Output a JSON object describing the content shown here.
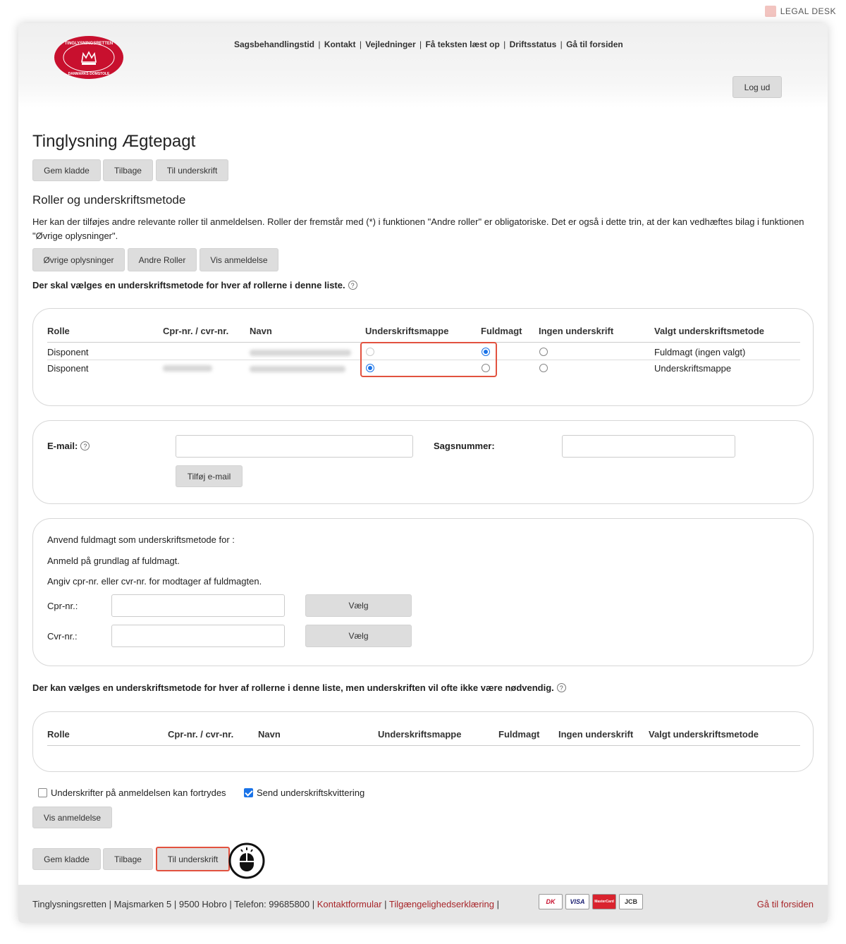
{
  "brand": {
    "name": "LEGAL DESK"
  },
  "header": {
    "nav": [
      "Sagsbehandlingstid",
      "Kontakt",
      "Vejledninger",
      "Få teksten læst op",
      "Driftsstatus",
      "Gå til forsiden"
    ],
    "logout_label": "Log ud",
    "seal_top": "TINGLYSNINGSRETTEN",
    "seal_bottom": "DANMARKS DOMSTOLE"
  },
  "page": {
    "title": "Tinglysning Ægtepagt",
    "actions": {
      "save": "Gem kladde",
      "back": "Tilbage",
      "sign": "Til underskrift"
    },
    "subtitle": "Roller og underskriftsmetode",
    "description": "Her kan der tilføjes andre relevante roller til anmeldelsen. Roller der fremstår med (*) i funktionen \"Andre roller\" er obligatoriske. Det er også i dette trin, at der kan vedhæftes bilag i funktionen \"Øvrige oplysninger\".",
    "section_tabs": {
      "other_info": "Øvrige oplysninger",
      "other_roles": "Andre Roller",
      "show_filing": "Vis anmeldelse"
    },
    "required_heading": "Der skal vælges en underskriftsmetode for hver af rollerne i denne liste.",
    "optional_heading": "Der kan vælges en underskriftsmetode for hver af rollerne i denne liste, men underskriften vil ofte ikke være nødvendig.",
    "help_glyph": "?"
  },
  "roles_table": {
    "columns": [
      "Rolle",
      "Cpr-nr. / cvr-nr.",
      "Navn",
      "Underskriftsmappe",
      "Fuldmagt",
      "Ingen underskrift",
      "Valgt underskriftsmetode"
    ],
    "rows": [
      {
        "role": "Disponent",
        "selected": "fuldmagt",
        "chosen_method": "Fuldmagt (ingen valgt)"
      },
      {
        "role": "Disponent",
        "selected": "underskriftsmappe",
        "chosen_method": "Underskriftsmappe"
      }
    ]
  },
  "email_panel": {
    "email_label": "E-mail:",
    "case_label": "Sagsnummer:",
    "add_email": "Tilføj e-mail"
  },
  "proxy_panel": {
    "line1": "Anvend fuldmagt som underskriftsmetode for :",
    "line2": "Anmeld på grundlag af fuldmagt.",
    "line3": "Angiv cpr-nr. eller cvr-nr. for modtager af fuldmagten.",
    "cpr_label": "Cpr-nr.:",
    "cvr_label": "Cvr-nr.:",
    "choose": "Vælg"
  },
  "optional_table": {
    "columns": [
      "Rolle",
      "Cpr-nr. / cvr-nr.",
      "Navn",
      "Underskriftsmappe",
      "Fuldmagt",
      "Ingen underskrift",
      "Valgt underskriftsmetode"
    ]
  },
  "options": {
    "revocable": {
      "label": "Underskrifter på anmeldelsen kan fortrydes",
      "checked": false
    },
    "receipt": {
      "label": "Send underskriftskvittering",
      "checked": true
    },
    "show_filing": "Vis anmeldelse"
  },
  "footer": {
    "address": "Tinglysningsretten | Majsmarken 5 | 9500 Hobro | Telefon: 99685800 |",
    "contact": "Kontaktformular",
    "accessibility": "Tilgængelighedserklæring",
    "cards": [
      "DK",
      "VISA",
      "MasterCard",
      "JCB"
    ],
    "home": "Gå til forsiden"
  },
  "colors": {
    "accent_red": "#c8102e",
    "highlight": "#e2523f",
    "radio_blue": "#1a73e8",
    "link_red": "#a8262a"
  }
}
